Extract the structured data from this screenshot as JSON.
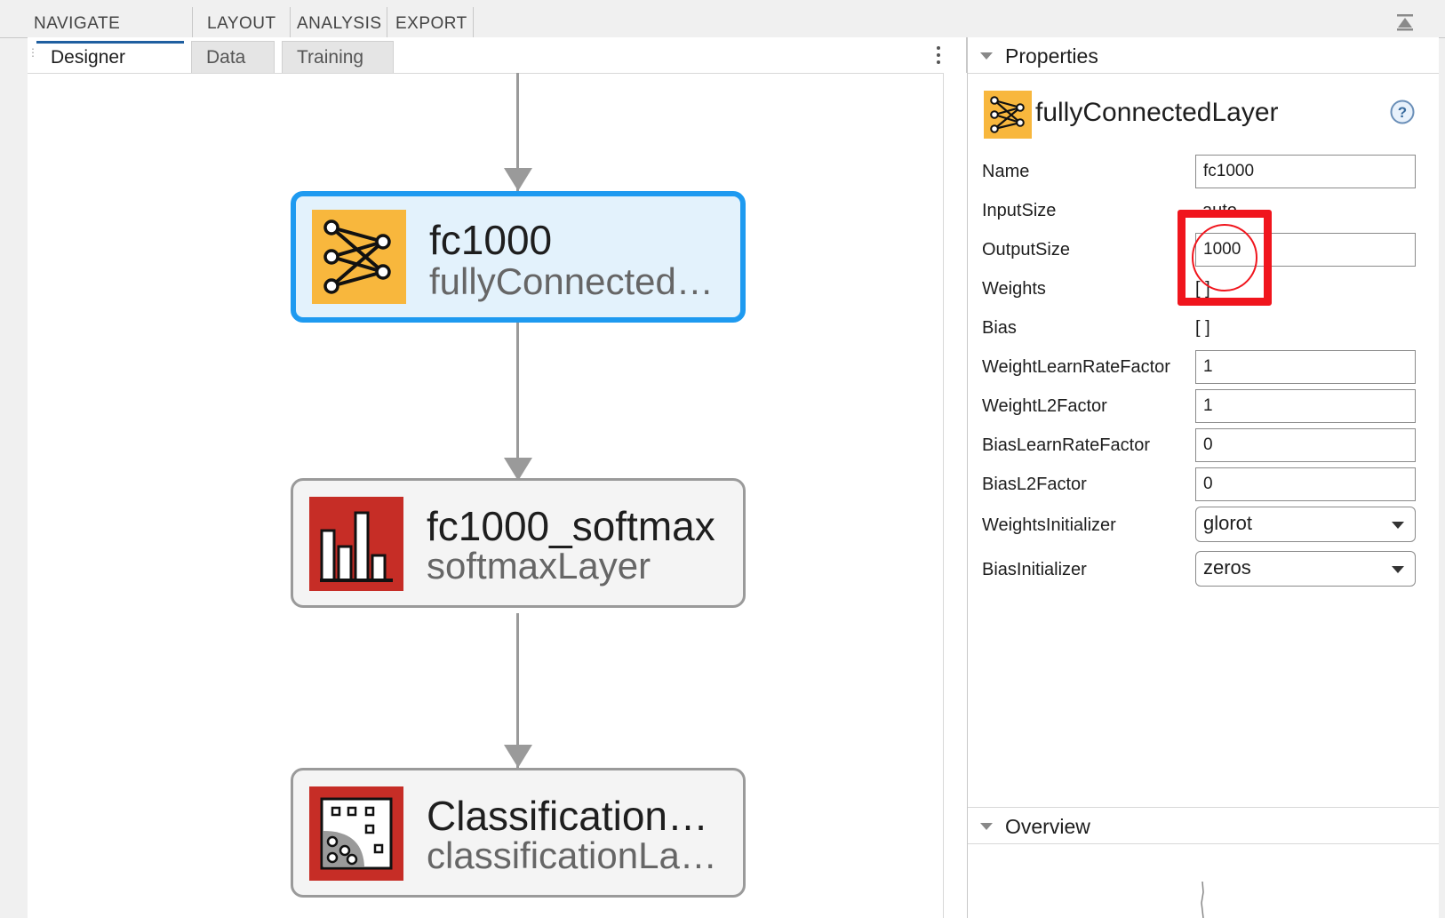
{
  "toolstrip": {
    "tabs": [
      "NAVIGATE",
      "LAYOUT",
      "ANALYSIS",
      "EXPORT"
    ]
  },
  "document_tabs": [
    "Designer",
    "Data",
    "Training"
  ],
  "diagram": {
    "nodes": [
      {
        "name": "fc1000",
        "type": "fullyConnected…",
        "icon": "fully-connected-icon",
        "color": "#f8b73d",
        "selected": true
      },
      {
        "name": "fc1000_softmax",
        "type": "softmaxLayer",
        "icon": "softmax-icon",
        "color": "#c62d26",
        "selected": false
      },
      {
        "name": "Classification…",
        "type": "classificationLa…",
        "icon": "classification-icon",
        "color": "#c62d26",
        "selected": false
      }
    ]
  },
  "properties": {
    "header": "Properties",
    "layer_type": "fullyConnectedLayer",
    "fields": {
      "name": {
        "label": "Name",
        "value": "fc1000"
      },
      "input_size": {
        "label": "InputSize",
        "value": "auto"
      },
      "output_size": {
        "label": "OutputSize",
        "value": "1000"
      },
      "weights": {
        "label": "Weights",
        "value": "[ ]"
      },
      "bias": {
        "label": "Bias",
        "value": "[ ]"
      },
      "weight_lr": {
        "label": "WeightLearnRateFactor",
        "value": "1"
      },
      "weight_l2": {
        "label": "WeightL2Factor",
        "value": "1"
      },
      "bias_lr": {
        "label": "BiasLearnRateFactor",
        "value": "0"
      },
      "bias_l2": {
        "label": "BiasL2Factor",
        "value": "0"
      },
      "weights_init": {
        "label": "WeightsInitializer",
        "value": "glorot"
      },
      "bias_init": {
        "label": "BiasInitializer",
        "value": "zeros"
      }
    }
  },
  "overview": {
    "header": "Overview"
  },
  "colors": {
    "selection_blue": "#1e9af0",
    "highlight_red": "#f0151d",
    "fc_orange": "#f8b73d",
    "layer_red": "#c62d26"
  }
}
